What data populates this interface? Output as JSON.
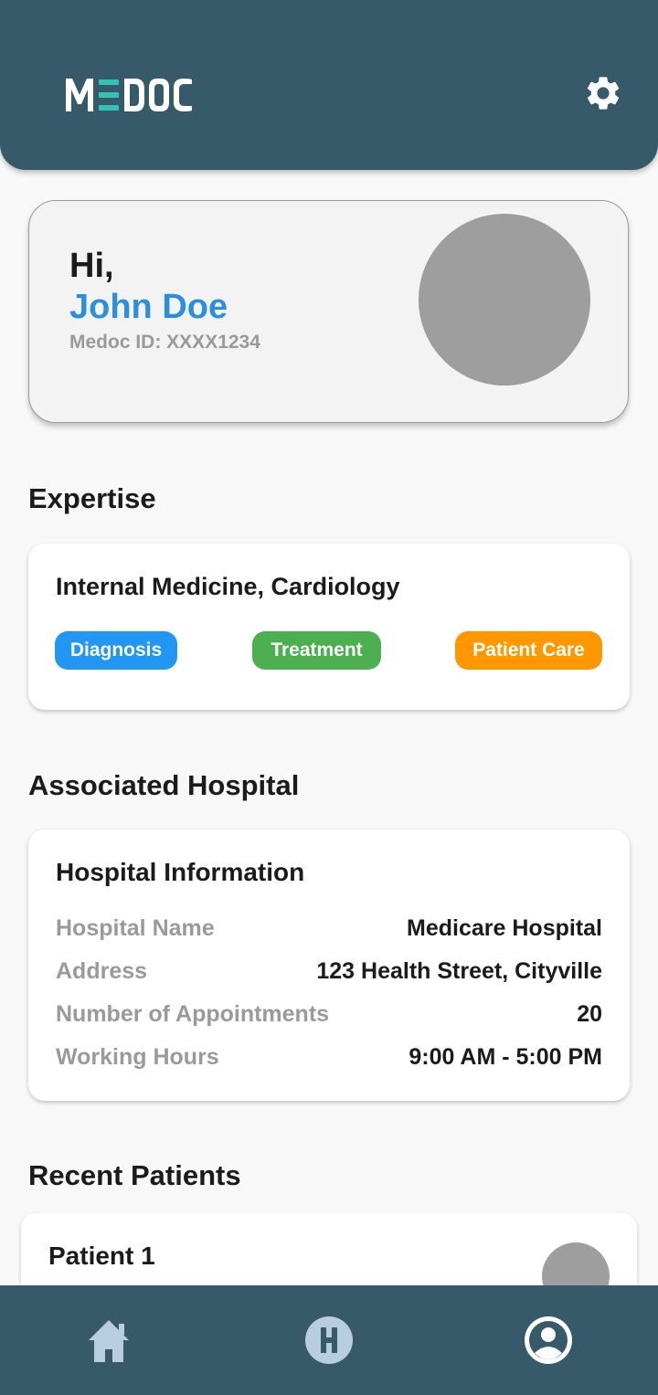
{
  "app": {
    "logo_text": "MEDOC"
  },
  "colors": {
    "primary": "#375a6b",
    "accent_teal": "#2ec4b6",
    "name_blue": "#2d8fdb",
    "chip_diagnosis": "#2196f3",
    "chip_treatment": "#4caf50",
    "chip_patient_care": "#ff9800"
  },
  "header": {
    "settings_icon": "gear-icon"
  },
  "profile": {
    "greeting": "Hi,",
    "name": "John Doe",
    "medoc_id": "Medoc ID: XXXX1234"
  },
  "expertise": {
    "section_title": "Expertise",
    "specialties": "Internal Medicine, Cardiology",
    "tags": [
      "Diagnosis",
      "Treatment",
      "Patient Care"
    ]
  },
  "hospital": {
    "section_title": "Associated Hospital",
    "card_title": "Hospital Information",
    "rows": [
      {
        "label": "Hospital Name",
        "value": "Medicare Hospital"
      },
      {
        "label": "Address",
        "value": "123 Health Street, Cityville"
      },
      {
        "label": "Number of Appointments",
        "value": "20"
      },
      {
        "label": "Working Hours",
        "value": "9:00 AM - 5:00 PM"
      }
    ]
  },
  "recent_patients": {
    "section_title": "Recent Patients",
    "items": [
      {
        "name": "Patient 1"
      }
    ]
  },
  "bottom_nav": {
    "items": [
      {
        "icon": "home-icon"
      },
      {
        "icon": "hospital-icon"
      },
      {
        "icon": "profile-icon"
      }
    ]
  }
}
